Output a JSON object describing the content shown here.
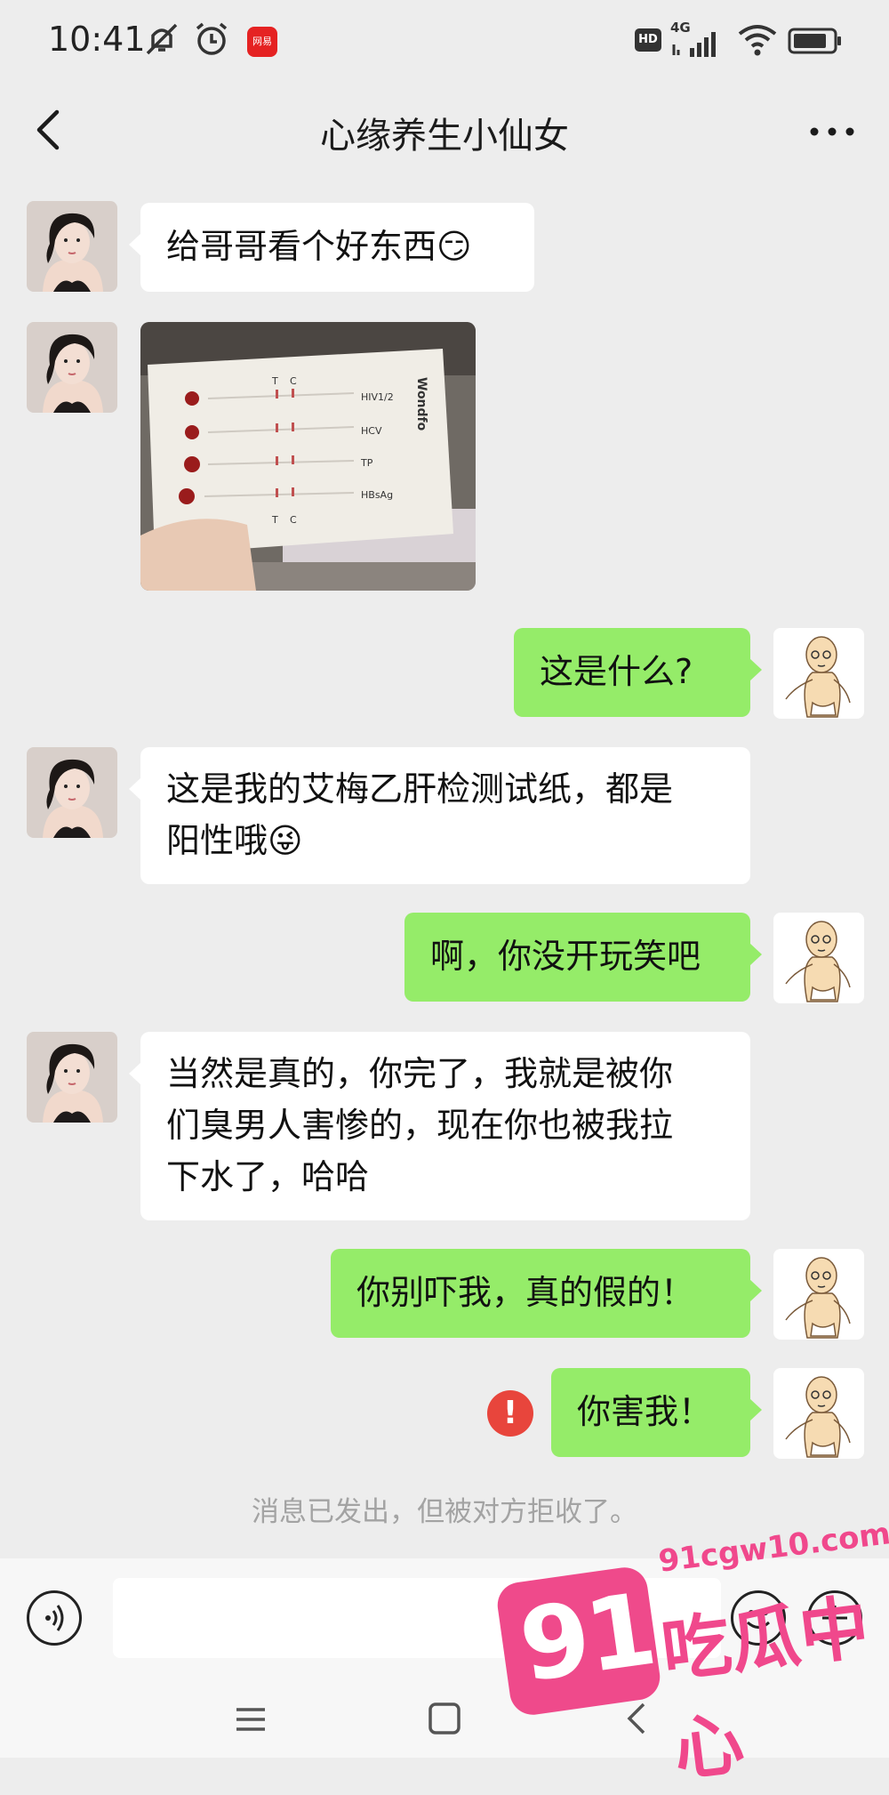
{
  "status_bar": {
    "time": "10:41",
    "badge_text": "网易",
    "network_label": "4G",
    "hd_label": "HD",
    "icons": [
      "mute-icon",
      "alarm-icon",
      "hd-icon",
      "signal-icon",
      "wifi-icon",
      "battery-icon"
    ]
  },
  "header": {
    "title": "心缘养生小仙女",
    "back_icon": "chevron-left-icon",
    "more_icon": "more-icon"
  },
  "messages": [
    {
      "side": "left",
      "type": "text",
      "text": "给哥哥看个好东西😏"
    },
    {
      "side": "left",
      "type": "image",
      "image_labels": [
        "T",
        "C",
        "HIV1/2",
        "HCV",
        "TP",
        "HBsAg",
        "T",
        "C",
        "Wondfo"
      ]
    },
    {
      "side": "right",
      "type": "text",
      "text": "这是什么?"
    },
    {
      "side": "left",
      "type": "text",
      "lines": [
        "这是我的艾梅乙肝检测试纸，都是",
        "阳性哦😜"
      ]
    },
    {
      "side": "right",
      "type": "text",
      "text": "啊，你没开玩笑吧"
    },
    {
      "side": "left",
      "type": "text",
      "lines": [
        "当然是真的，你完了，我就是被你",
        "们臭男人害惨的，现在你也被我拉",
        "下水了，哈哈"
      ]
    },
    {
      "side": "right",
      "type": "text",
      "text": "你别吓我，真的假的！"
    },
    {
      "side": "right",
      "type": "text",
      "text": "你害我！",
      "status": "failed",
      "fail_mark": "!"
    }
  ],
  "system_notice": "消息已发出，但被对方拒收了。",
  "input_bar": {
    "voice_icon": "voice-icon",
    "emoji_icon": "emoji-icon",
    "plus_icon": "plus-icon"
  },
  "nav_bar": {
    "icons": [
      "menu-icon",
      "home-icon",
      "back-icon"
    ]
  },
  "watermark": {
    "url": "91cgw10.com",
    "logo": "91",
    "text": "吃瓜中心"
  },
  "colors": {
    "background": "#ededed",
    "sent_bubble": "#95ec69",
    "received_bubble": "#ffffff",
    "error": "#e8453c",
    "watermark": "#f0488c"
  }
}
